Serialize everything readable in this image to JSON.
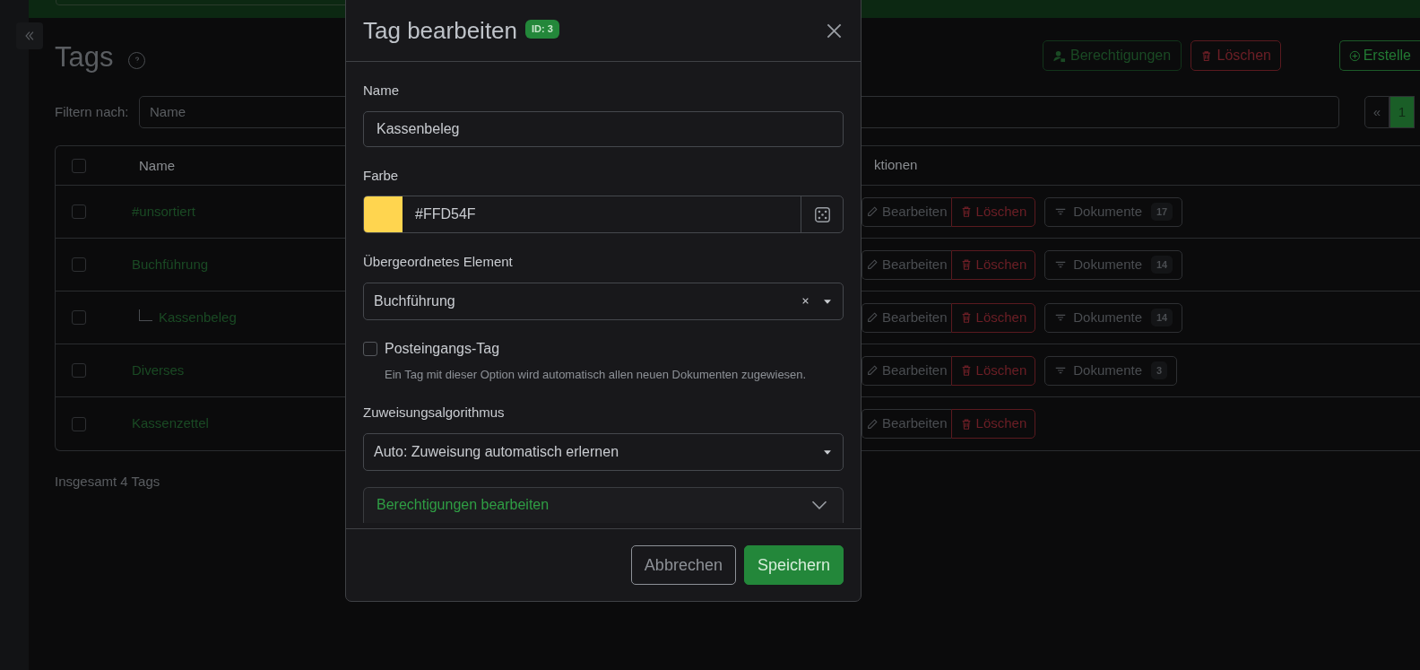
{
  "page": {
    "title": "Tags",
    "actions": [
      {
        "kind": "permissions",
        "label": "Berechtigungen"
      },
      {
        "kind": "delete",
        "label": "Löschen"
      },
      {
        "kind": "create",
        "label": "Erstelle"
      }
    ]
  },
  "filter": {
    "label": "Filtern nach:",
    "select": "Name"
  },
  "pagination": [
    {
      "label": "«",
      "selected": false
    },
    {
      "label": "1",
      "selected": true
    }
  ],
  "table": {
    "header_checked": false,
    "columns": [
      "Name",
      "ktionen"
    ],
    "rows": [
      {
        "name": "#unsortiert",
        "checked": false,
        "edit": "Bearbeiten",
        "delete": "Löschen",
        "documents": {
          "label": "Dokumente",
          "count": "17"
        }
      },
      {
        "name": "Buchführung",
        "checked": false,
        "edit": "Bearbeiten",
        "delete": "Löschen",
        "documents": {
          "label": "Dokumente",
          "count": "14"
        },
        "children": [
          {
            "name": "Kassenbeleg",
            "checked": false,
            "edit": "Bearbeiten",
            "delete": "Löschen",
            "documents": {
              "label": "Dokumente",
              "count": "14"
            }
          }
        ]
      },
      {
        "name": "Diverses",
        "checked": false,
        "edit": "Bearbeiten",
        "delete": "Löschen",
        "documents": {
          "label": "Dokumente",
          "count": "3"
        }
      },
      {
        "name": "Kassenzettel",
        "checked": false,
        "edit": "Bearbeiten",
        "delete": "Löschen"
      }
    ]
  },
  "total": "Insgesamt 4 Tags",
  "dialog": {
    "title": "Tag bearbeiten",
    "badge": "ID: 3",
    "name": {
      "label": "Name",
      "value": "Kassenbeleg"
    },
    "color": {
      "label": "Farbe",
      "value": "#FFD54F",
      "color": "#ffd54f"
    },
    "parent": {
      "label": "Übergeordnetes Element",
      "value": "Buchführung"
    },
    "inbox": {
      "label": "Posteingangs-Tag",
      "checked": false,
      "hint": "Ein Tag mit dieser Option wird automatisch allen neuen Dokumenten zugewiesen."
    },
    "algorithm": {
      "label": "Zuweisungsalgorithmus",
      "value": "Auto: Zuweisung automatisch erlernen"
    },
    "permissions": {
      "label": "Berechtigungen bearbeiten",
      "expanded": false
    },
    "buttons": [
      {
        "kind": "cancel",
        "label": "Abbrechen"
      },
      {
        "kind": "save",
        "label": "Speichern"
      }
    ]
  }
}
